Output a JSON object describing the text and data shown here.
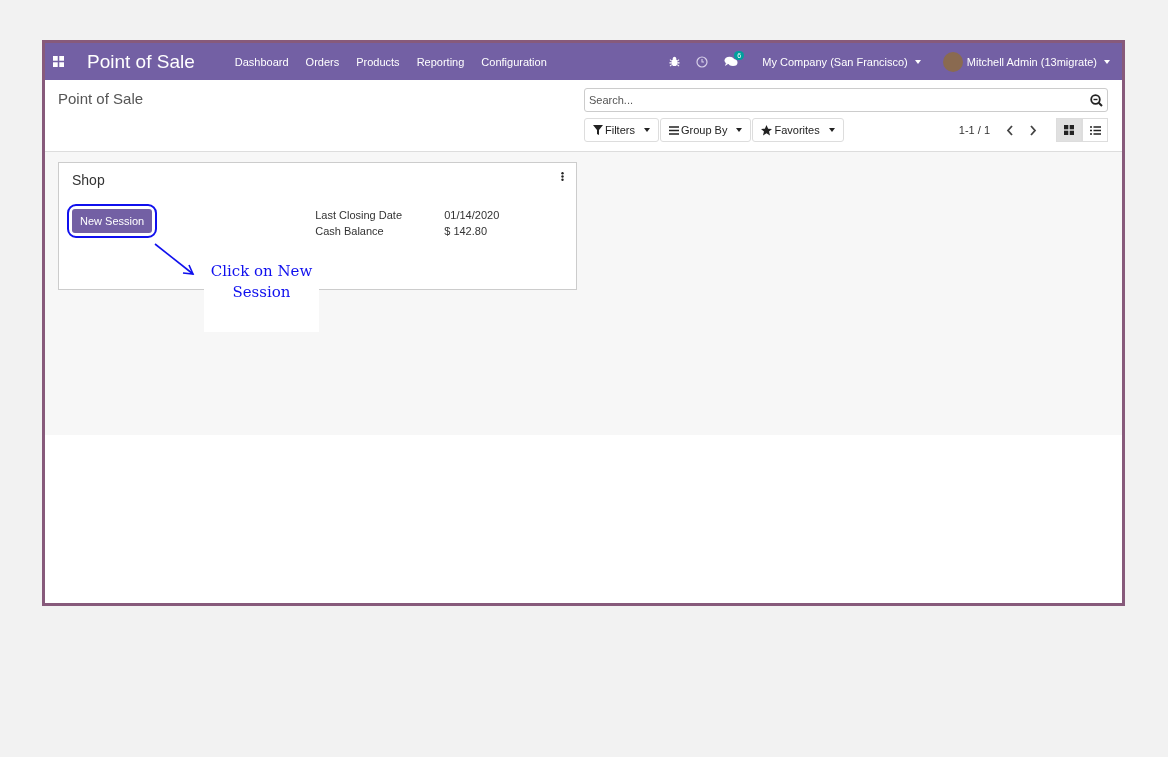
{
  "navbar": {
    "app_title": "Point of Sale",
    "menu": [
      "Dashboard",
      "Orders",
      "Products",
      "Reporting",
      "Configuration"
    ],
    "messages_count": "6",
    "company": "My Company (San Francisco)",
    "user": "Mitchell Admin (13migrate)"
  },
  "control_panel": {
    "breadcrumb": "Point of Sale",
    "search": {
      "placeholder": "Search..."
    },
    "filters": [
      {
        "kind": "filter",
        "label": "Filters"
      },
      {
        "kind": "group",
        "label": "Group By"
      },
      {
        "kind": "favorite",
        "label": "Favorites"
      }
    ],
    "pager": "1-1 / 1",
    "views": [
      {
        "kind": "kanban",
        "selected": true
      },
      {
        "kind": "list",
        "selected": false
      }
    ]
  },
  "card": {
    "title": "Shop",
    "button": "New Session",
    "fields": [
      {
        "label": "Last Closing Date",
        "value": "01/14/2020"
      },
      {
        "label": "Cash Balance",
        "value": "$ 142.80"
      }
    ]
  },
  "annotation": {
    "text": "Click on New Session"
  }
}
